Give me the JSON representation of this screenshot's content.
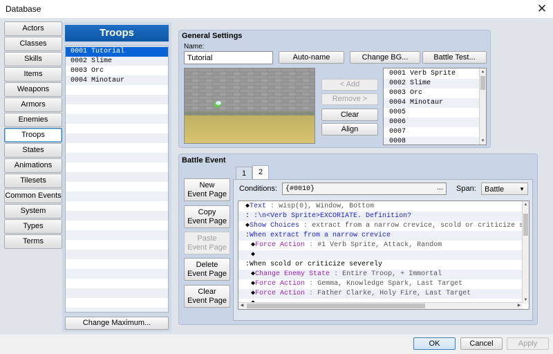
{
  "window": {
    "title": "Database"
  },
  "nav": [
    {
      "label": "Actors"
    },
    {
      "label": "Classes"
    },
    {
      "label": "Skills"
    },
    {
      "label": "Items"
    },
    {
      "label": "Weapons"
    },
    {
      "label": "Armors"
    },
    {
      "label": "Enemies"
    },
    {
      "label": "Troops",
      "selected": true
    },
    {
      "label": "States"
    },
    {
      "label": "Animations"
    },
    {
      "label": "Tilesets"
    },
    {
      "label": "Common Events"
    },
    {
      "label": "System"
    },
    {
      "label": "Types"
    },
    {
      "label": "Terms"
    }
  ],
  "troops": {
    "header": "Troops",
    "items": [
      "0001 Tutorial",
      "0002 Slime",
      "0003 Orc",
      "0004 Minotaur"
    ],
    "selected_index": 0,
    "change_max": "Change Maximum..."
  },
  "general": {
    "title": "General Settings",
    "name_label": "Name:",
    "name_value": "Tutorial",
    "auto_name": "Auto-name",
    "change_bg": "Change BG...",
    "battle_test": "Battle Test...",
    "add": "< Add",
    "remove": "Remove >",
    "clear": "Clear",
    "align": "Align",
    "members": [
      "0001 Verb Sprite",
      "0002 Slime",
      "0003 Orc",
      "0004 Minotaur",
      "0005",
      "0006",
      "0007",
      "0008"
    ]
  },
  "battle_event": {
    "title": "Battle Event",
    "tabs": [
      "1",
      "2"
    ],
    "selected_tab": 1,
    "new_page": [
      "New",
      "Event Page"
    ],
    "copy_page": [
      "Copy",
      "Event Page"
    ],
    "paste_page": [
      "Paste",
      "Event Page"
    ],
    "delete_page": [
      "Delete",
      "Event Page"
    ],
    "clear_page": [
      "Clear",
      "Event Page"
    ],
    "conditions_label": "Conditions:",
    "conditions_value": "{#0010}",
    "conditions_button": "...",
    "span_label": "Span:",
    "span_value": "Battle",
    "lines": [
      {
        "indent": 1,
        "bullet": "◆",
        "cmd": "Text",
        "args": "wisp(0), Window, Bottom",
        "color": "#2222cc"
      },
      {
        "indent": 1,
        "bullet": ":",
        "cmd": "",
        "args": "    :\\n<Verb Sprite>EXCORIATE. Definition?",
        "color": "#2222cc"
      },
      {
        "indent": 1,
        "bullet": "◆",
        "cmd": "Show Choices",
        "args": "extract from a narrow crevice, scold or criticize severely, free somed",
        "color": "#2222cc"
      },
      {
        "indent": 1,
        "bullet": ":",
        "cmd": "When extract from a narrow crevice",
        "args": "",
        "color": "#2222cc"
      },
      {
        "indent": 2,
        "bullet": "◆",
        "cmd": "Force Action",
        "args": "#1 Verb Sprite, Attack, Random",
        "color": "#9b1fb8"
      },
      {
        "indent": 2,
        "bullet": "◆",
        "cmd": "",
        "args": "",
        "color": "#000000"
      },
      {
        "indent": 1,
        "bullet": ":",
        "cmd": "When scold or criticize severely",
        "args": "",
        "color": "#000000"
      },
      {
        "indent": 2,
        "bullet": "◆",
        "cmd": "Change Enemy State",
        "args": "Entire Troop, + Immortal",
        "color": "#9b1fb8"
      },
      {
        "indent": 2,
        "bullet": "◆",
        "cmd": "Force Action",
        "args": "Gemma, Knowledge Spark, Last Target",
        "color": "#9b1fb8"
      },
      {
        "indent": 2,
        "bullet": "◆",
        "cmd": "Force Action",
        "args": "Father Clarke, Holy Fire, Last Target",
        "color": "#9b1fb8"
      },
      {
        "indent": 2,
        "bullet": "◆",
        "cmd": "",
        "args": "",
        "color": "#000000"
      }
    ]
  },
  "footer": {
    "ok": "OK",
    "cancel": "Cancel",
    "apply": "Apply"
  }
}
